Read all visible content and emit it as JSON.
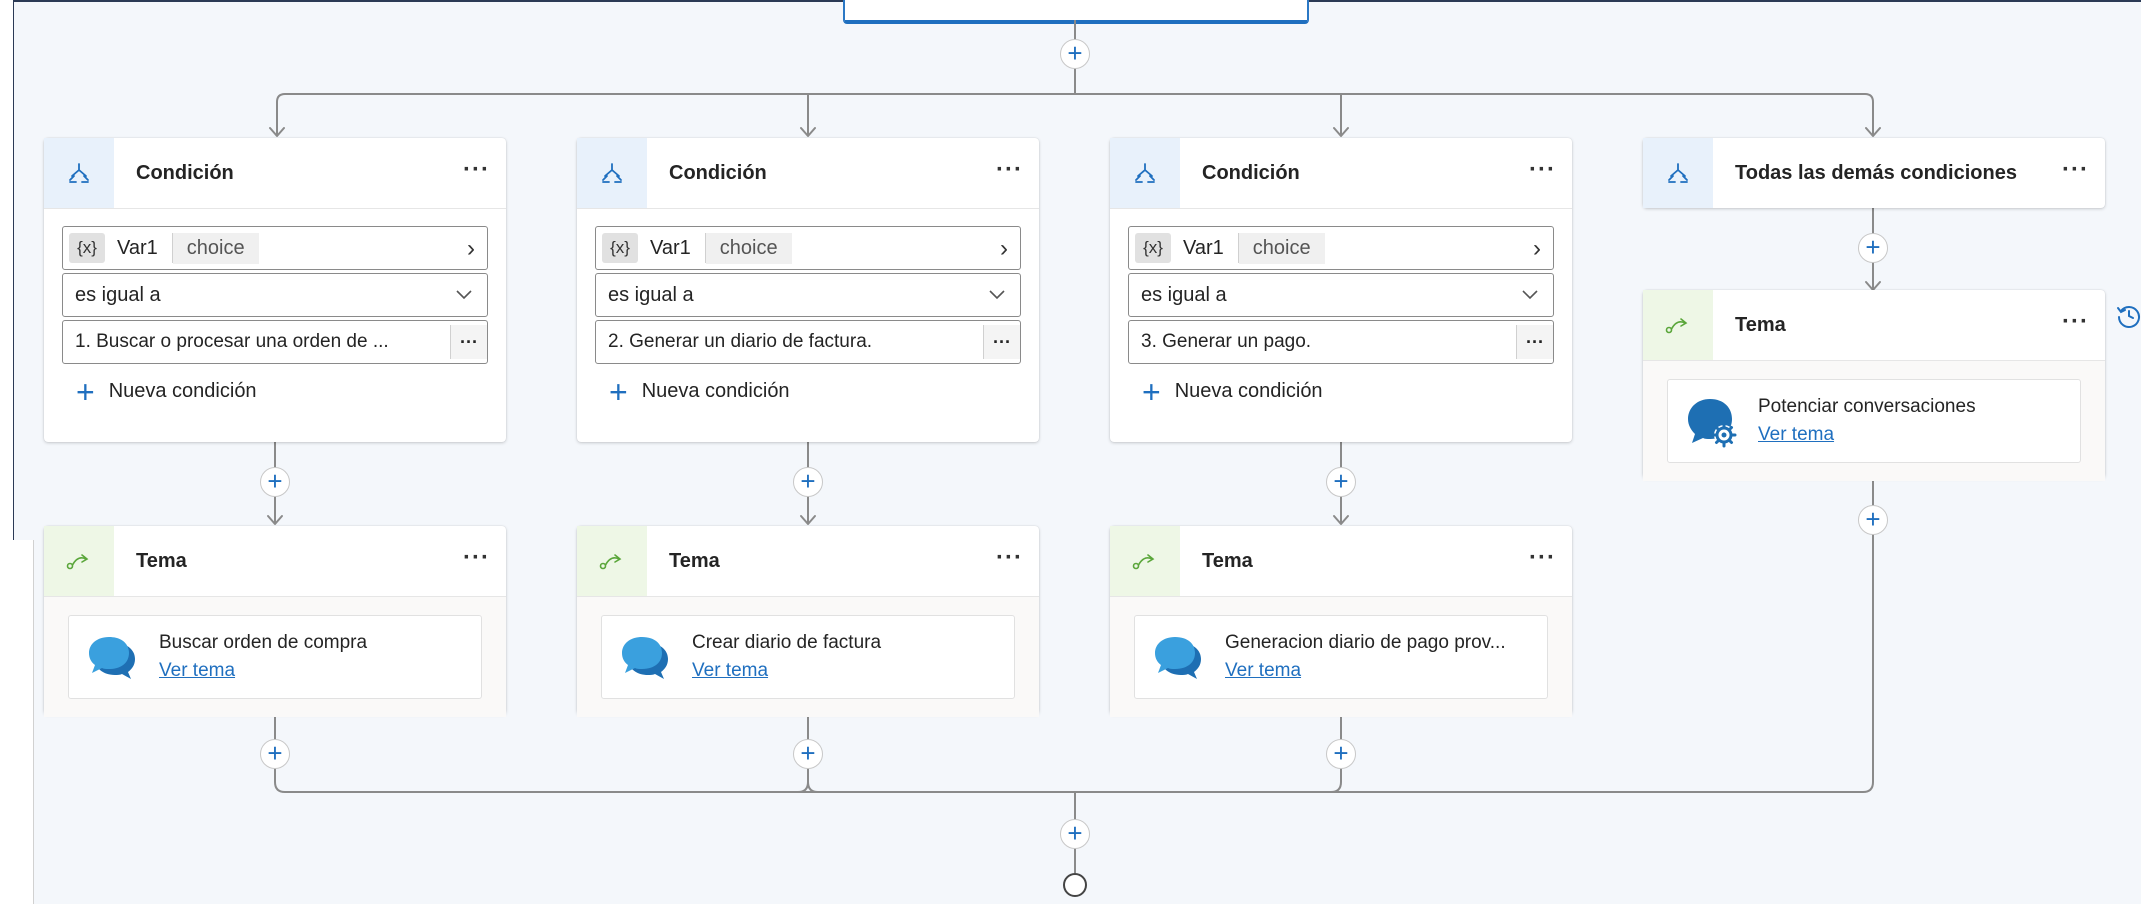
{
  "branches": [
    {
      "condition": {
        "title": "Condición",
        "variable": "Var1",
        "var_type": "choice",
        "var_badge": "{x}",
        "operator": "es igual a",
        "value": "1. Buscar o procesar una orden de ...",
        "new_condition": "Nueva condición"
      },
      "topic": {
        "title": "Tema",
        "name": "Buscar orden de compra",
        "link": "Ver tema"
      }
    },
    {
      "condition": {
        "title": "Condición",
        "variable": "Var1",
        "var_type": "choice",
        "var_badge": "{x}",
        "operator": "es igual a",
        "value": "2. Generar un diario de factura.",
        "new_condition": "Nueva condición"
      },
      "topic": {
        "title": "Tema",
        "name": "Crear diario de factura",
        "link": "Ver tema"
      }
    },
    {
      "condition": {
        "title": "Condición",
        "variable": "Var1",
        "var_type": "choice",
        "var_badge": "{x}",
        "operator": "es igual a",
        "value": "3. Generar un pago.",
        "new_condition": "Nueva condición"
      },
      "topic": {
        "title": "Tema",
        "name": "Generacion diario de pago prov...",
        "link": "Ver tema"
      }
    }
  ],
  "else_branch": {
    "title": "Todas las demás condiciones",
    "topic": {
      "title": "Tema",
      "name": "Potenciar conversaciones",
      "link": "Ver tema"
    }
  },
  "icons": {
    "condition": "branch-icon",
    "topic": "redirect-icon",
    "topic_chat": "chat-bubbles-icon",
    "topic_boost": "chat-gear-icon",
    "history": "history-icon",
    "more": "more-icon",
    "add": "plus-icon"
  },
  "glyphs": {
    "more": "···",
    "add": "+",
    "chevron_right": "›"
  },
  "colors": {
    "accent": "#1f6fbf",
    "condition_header_bg": "#e8f1fb",
    "topic_header_bg": "#eef7e6",
    "topic_icon_green": "#5aa63a",
    "canvas_bg": "#f4f7fb",
    "connector": "#8a8a8a"
  }
}
